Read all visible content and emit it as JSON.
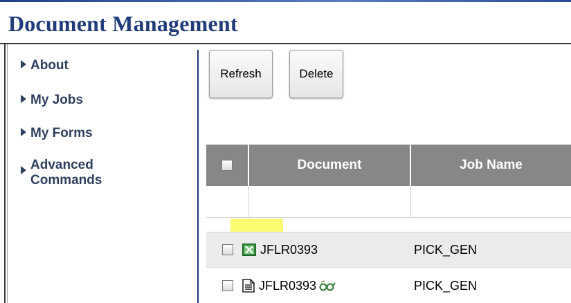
{
  "app": {
    "title": "Document Management"
  },
  "sidebar": {
    "items": [
      {
        "label": "About"
      },
      {
        "label": "My Jobs"
      },
      {
        "label": "My Forms"
      },
      {
        "label_line1": "Advanced",
        "label_line2": "Commands"
      }
    ]
  },
  "toolbar": {
    "refresh_label": "Refresh",
    "delete_label": "Delete"
  },
  "table": {
    "columns": [
      {
        "label": "Document"
      },
      {
        "label": "Job Name"
      }
    ],
    "rows": [
      {
        "document": "JFLR0393",
        "job_name": "PICK_GEN",
        "doc_icon": "spreadsheet-icon",
        "highlighted": true
      },
      {
        "document": "JFLR0393",
        "job_name": "PICK_GEN",
        "doc_icon": "text-document-icon",
        "extra_icon": "view-glasses-icon"
      }
    ]
  },
  "colors": {
    "title": "#1f3b7a",
    "header_bg": "#878787",
    "highlight": "#fbfb5a",
    "nav_text": "#2d3f5e"
  }
}
